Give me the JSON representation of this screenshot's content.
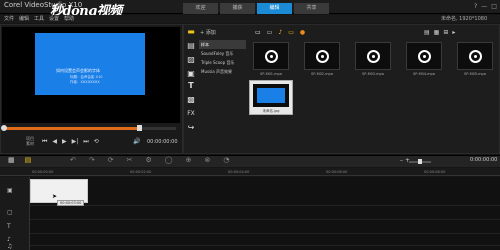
{
  "app": {
    "title": "Corel VideoStudio X10",
    "watermark": "秒dong视频",
    "window_buttons": [
      "?",
      "—",
      "□",
      "×"
    ],
    "menu": [
      "文件",
      "编辑",
      "工具",
      "设置",
      "帮助"
    ],
    "resolution_label": "未命名, 1920*1080"
  },
  "tabs": [
    {
      "label": "欢迎",
      "active": false
    },
    {
      "label": "捕获",
      "active": false
    },
    {
      "label": "编辑",
      "active": true
    },
    {
      "label": "共享",
      "active": false
    }
  ],
  "preview": {
    "frame_lines": [
      "如何设置会声会影的字体",
      "标题：会声会影 X10",
      "作者：XXXXXXXX"
    ],
    "progress_percent": 78,
    "project_label": "项目",
    "clip_label": "素材",
    "transport": [
      "⏮",
      "◀",
      "▶",
      "▶|",
      "⏭",
      "⟲"
    ],
    "speaker_icon": "🔊",
    "timecode": "00:00:00:00"
  },
  "library": {
    "add_label": "+ 添加",
    "categories": [
      {
        "label": "样本",
        "selected": true
      },
      {
        "label": "SoundFoley 音乐",
        "selected": false
      },
      {
        "label": "Triple Scoop 音乐",
        "selected": false
      },
      {
        "label": "Mussia 声音效果",
        "selected": false
      }
    ],
    "toolbar_icons": [
      {
        "glyph": "▭",
        "color": "#ffffff"
      },
      {
        "glyph": "▭",
        "color": "#dddddd"
      },
      {
        "glyph": "♪",
        "color": "#f0c419"
      },
      {
        "glyph": "▭",
        "color": "#f0c419"
      },
      {
        "glyph": "●",
        "color": "#f08c1a"
      }
    ],
    "view_icons": [
      "▤",
      "▦",
      "⊞",
      "▸"
    ],
    "thumbnails": [
      {
        "label": "SP-M01.mpa"
      },
      {
        "label": "SP-M02.mpa"
      },
      {
        "label": "SP-M03.mpa"
      },
      {
        "label": "SP-M04.mpa"
      },
      {
        "label": "SP-M05.mpa"
      }
    ],
    "selected_thumb_label": "未命名.jpg"
  },
  "timeline": {
    "left_icons": [
      "▦",
      "▤"
    ],
    "tool_icons": [
      "↶",
      "↷",
      "⟳",
      "✂",
      "⚙",
      "◯",
      "⊕",
      "⊗",
      "◔"
    ],
    "zoom_label": "–     +",
    "timecode": "0:00:00:00",
    "ruler_ticks": [
      "00:00:00:00",
      "00:00:02:00",
      "00:00:04:00",
      "00:00:06:00",
      "00:00:08:00"
    ],
    "clip_tooltip": "00:00:03:00",
    "track_icons": [
      "▣",
      "▢",
      "T",
      "♪",
      "♫"
    ]
  }
}
